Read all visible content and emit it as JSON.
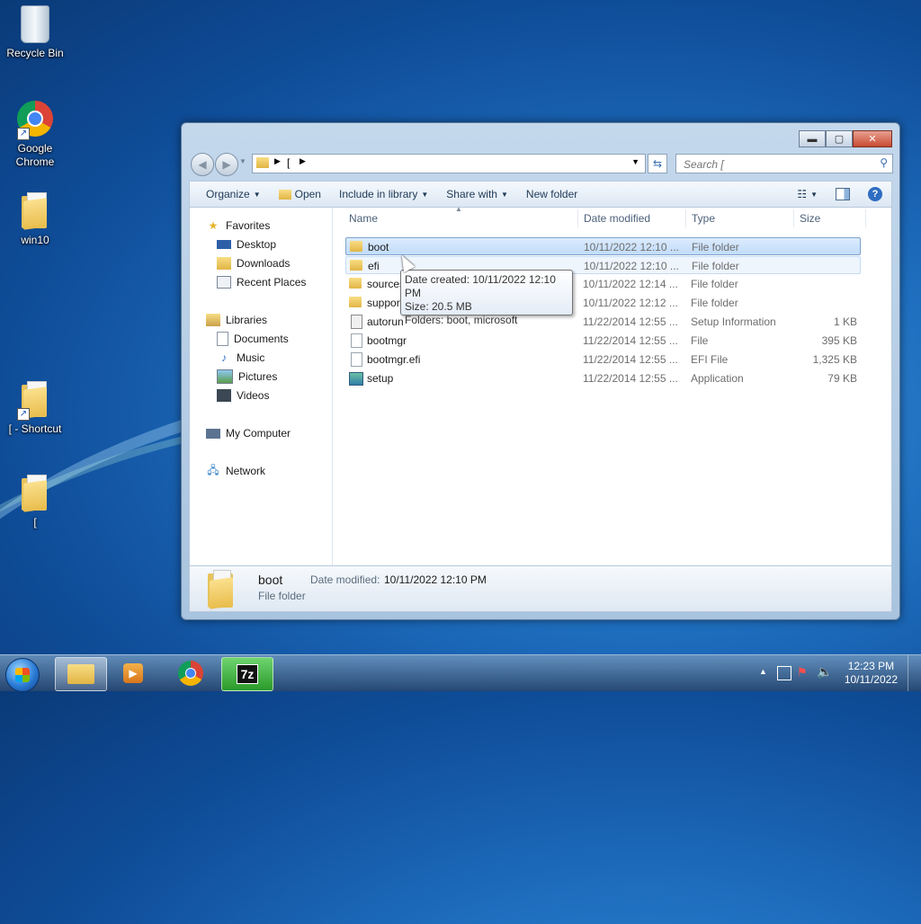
{
  "desktop": {
    "icons": [
      {
        "label": "Recycle Bin"
      },
      {
        "label": "Google\nChrome"
      },
      {
        "label": "win10"
      },
      {
        "label": "[ - Shortcut"
      },
      {
        "label": "["
      }
    ]
  },
  "window": {
    "address": {
      "segments": [
        "["
      ]
    },
    "search": {
      "placeholder": "Search ["
    },
    "caption": {
      "minimize": "▬",
      "maximize": "▢",
      "close": "✕"
    },
    "toolbar": {
      "organize": "Organize",
      "open": "Open",
      "include_in_library": "Include in library",
      "share_with": "Share with",
      "new_folder": "New folder"
    },
    "nav": {
      "favorites": "Favorites",
      "desktop": "Desktop",
      "downloads": "Downloads",
      "recent_places": "Recent Places",
      "libraries": "Libraries",
      "documents": "Documents",
      "music": "Music",
      "pictures": "Pictures",
      "videos": "Videos",
      "my_computer": "My Computer",
      "network": "Network"
    },
    "columns": {
      "name": "Name",
      "date_modified": "Date modified",
      "type": "Type",
      "size": "Size"
    },
    "files": [
      {
        "name": "boot",
        "date": "10/11/2022 12:10 ...",
        "type": "File folder",
        "size": "",
        "icon": "folder"
      },
      {
        "name": "efi",
        "date": "10/11/2022 12:10 ...",
        "type": "File folder",
        "size": "",
        "icon": "folder"
      },
      {
        "name": "sources",
        "date": "10/11/2022 12:14 ...",
        "type": "File folder",
        "size": "",
        "icon": "folder"
      },
      {
        "name": "support",
        "date": "10/11/2022 12:12 ...",
        "type": "File folder",
        "size": "",
        "icon": "folder"
      },
      {
        "name": "autorun",
        "date": "11/22/2014 12:55 ...",
        "type": "Setup Information",
        "size": "1 KB",
        "icon": "setup-information"
      },
      {
        "name": "bootmgr",
        "date": "11/22/2014 12:55 ...",
        "type": "File",
        "size": "395 KB",
        "icon": "file"
      },
      {
        "name": "bootmgr.efi",
        "date": "11/22/2014 12:55 ...",
        "type": "EFI File",
        "size": "1,325 KB",
        "icon": "file"
      },
      {
        "name": "setup",
        "date": "11/22/2014 12:55 ...",
        "type": "Application",
        "size": "79 KB",
        "icon": "application"
      }
    ],
    "tooltip": {
      "line1": "Date created: 10/11/2022 12:10 PM",
      "line2": "Size: 20.5 MB",
      "line3": "Folders: boot, microsoft"
    },
    "details": {
      "name": "boot",
      "date_label": "Date modified:",
      "date_value": "10/11/2022 12:10 PM",
      "type": "File folder"
    }
  },
  "taskbar": {
    "clock": {
      "time": "12:23 PM",
      "date": "10/11/2022"
    },
    "seven_zip_label": "7z",
    "tray_arrow": "▲"
  },
  "colors": {
    "selection": "#c1dcfc",
    "window_frame": "#a9c4df",
    "close_button": "#c84a32"
  }
}
